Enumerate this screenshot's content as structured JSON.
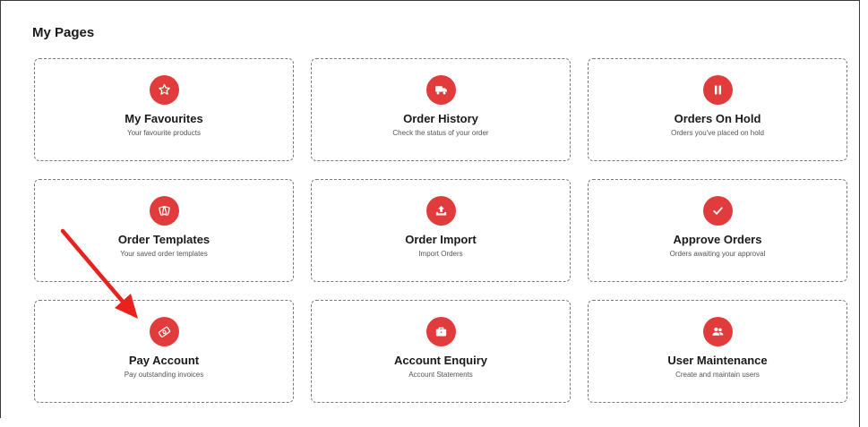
{
  "page": {
    "title": "My Pages"
  },
  "tiles": [
    {
      "title": "My Favourites",
      "subtitle": "Your favourite products",
      "icon": "star-icon"
    },
    {
      "title": "Order History",
      "subtitle": "Check the status of your order",
      "icon": "truck-icon"
    },
    {
      "title": "Orders On Hold",
      "subtitle": "Orders you've placed on hold",
      "icon": "pause-icon"
    },
    {
      "title": "Order Templates",
      "subtitle": "Your saved order templates",
      "icon": "template-icon"
    },
    {
      "title": "Order Import",
      "subtitle": "Import Orders",
      "icon": "upload-icon"
    },
    {
      "title": "Approve Orders",
      "subtitle": "Orders awaiting your approval",
      "icon": "check-icon"
    },
    {
      "title": "Pay Account",
      "subtitle": "Pay outstanding invoices",
      "icon": "money-icon"
    },
    {
      "title": "Account Enquiry",
      "subtitle": "Account Statements",
      "icon": "briefcase-icon"
    },
    {
      "title": "User Maintenance",
      "subtitle": "Create and maintain users",
      "icon": "users-icon"
    }
  ],
  "colors": {
    "accent": "#e23b3b",
    "annotation_arrow": "#e8231f",
    "border": "#7a7a7a",
    "text": "#1a1a1a"
  }
}
